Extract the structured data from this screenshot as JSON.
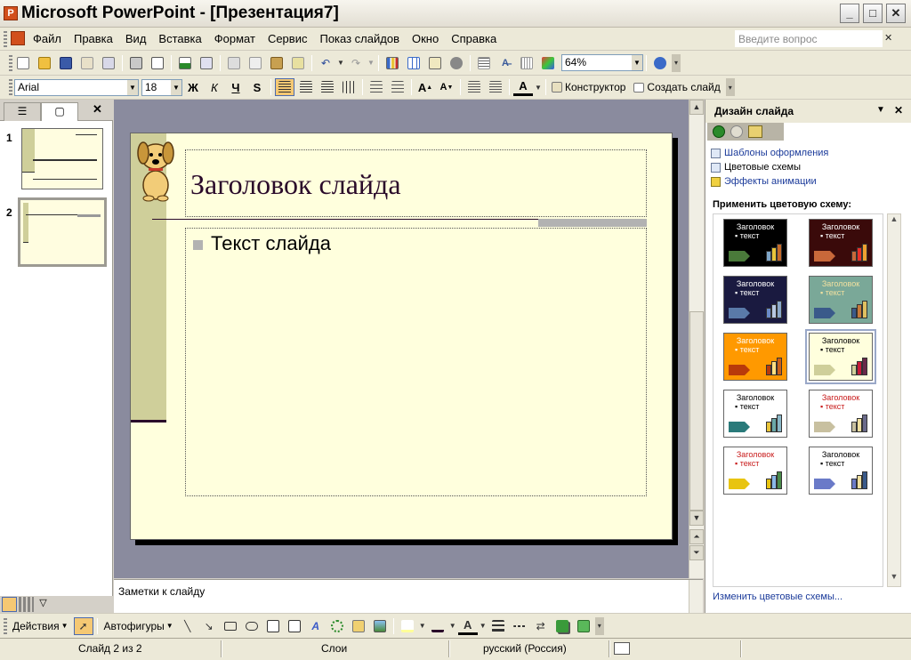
{
  "window": {
    "title": "Microsoft PowerPoint - [Презентация7]",
    "minimize": "_",
    "maximize": "□",
    "close": "✕"
  },
  "menu": {
    "items": [
      "Файл",
      "Правка",
      "Вид",
      "Вставка",
      "Формат",
      "Сервис",
      "Показ слайдов",
      "Окно",
      "Справка"
    ],
    "help_placeholder": "Введите вопрос",
    "help_close": "✕"
  },
  "standard_toolbar": {
    "zoom": "64%",
    "zoom_arrow": "▼"
  },
  "format_toolbar": {
    "font": "Arial",
    "font_size": "18",
    "bold": "Ж",
    "italic": "К",
    "underline": "Ч",
    "shadow": "S",
    "designer": "Конструктор",
    "new_slide": "Создать слайд"
  },
  "left_panel": {
    "close": "✕",
    "slides": [
      {
        "number": "1"
      },
      {
        "number": "2"
      }
    ]
  },
  "slide": {
    "title": "Заголовок слайда",
    "body": "Текст слайда"
  },
  "notes": {
    "placeholder": "Заметки к слайду"
  },
  "task_pane": {
    "title": "Дизайн слайда",
    "links": [
      "Шаблоны оформления",
      "Цветовые схемы",
      "Эффекты анимации"
    ],
    "apply_label": "Применить цветовую схему:",
    "footer_link": "Изменить цветовые схемы...",
    "schemes": [
      {
        "title": "Заголовок",
        "text": "текст",
        "bg": "#000000",
        "fg": "#ffffff",
        "arrow": "#4a7a3a",
        "bars": [
          "#7fa6c8",
          "#e8c43a",
          "#c46a2a"
        ]
      },
      {
        "title": "Заголовок",
        "text": "текст",
        "bg": "#3a0a0a",
        "fg": "#ffffff",
        "arrow": "#c8683a",
        "bars": [
          "#c8683a",
          "#e8302a",
          "#f0a030"
        ]
      },
      {
        "title": "Заголовок",
        "text": "текст",
        "bg": "#1a1a40",
        "fg": "#ffffff",
        "arrow": "#5a7aa8",
        "bars": [
          "#6a8ac8",
          "#b8c8e0",
          "#8aa8c8"
        ]
      },
      {
        "title": "Заголовок",
        "text": "текст",
        "bg": "#7aa898",
        "fg": "#f0e0a0",
        "arrow": "#3a5a8a",
        "bars": [
          "#3a5a8a",
          "#c87a3a",
          "#e0c060"
        ]
      },
      {
        "title": "Заголовок",
        "text": "текст",
        "bg": "#ff9900",
        "fg": "#ffffff",
        "arrow": "#b83a0a",
        "bars": [
          "#b83a0a",
          "#ffe080",
          "#c8601a"
        ]
      },
      {
        "title": "Заголовок",
        "text": "текст",
        "bg": "#ffffdd",
        "fg": "#000000",
        "arrow": "#cfcf9a",
        "bars": [
          "#cfcf9a",
          "#c81a3a",
          "#6a2a4a"
        ]
      },
      {
        "title": "Заголовок",
        "text": "текст",
        "bg": "#ffffff",
        "fg": "#000000",
        "arrow": "#2a7a7a",
        "bars": [
          "#e8c43a",
          "#6aa8a8",
          "#8ab8c8"
        ]
      },
      {
        "title": "Заголовок",
        "text": "текст",
        "bg": "#ffffff",
        "fg": "#c81a1a",
        "arrow": "#c8c0a0",
        "bars": [
          "#c8c0a0",
          "#f0e0a0",
          "#6a6a8a"
        ]
      },
      {
        "title": "Заголовок",
        "text": "текст",
        "bg": "#ffffff",
        "fg": "#c81a1a",
        "arrow": "#e8c410",
        "bars": [
          "#e8c410",
          "#8ab8e8",
          "#4a8a4a"
        ]
      },
      {
        "title": "Заголовок",
        "text": "текст",
        "bg": "#ffffff",
        "fg": "#000000",
        "arrow": "#6a7ac8",
        "bars": [
          "#6a7ac8",
          "#f0e0a0",
          "#3a5a8a"
        ]
      }
    ]
  },
  "draw_toolbar": {
    "actions": "Действия",
    "autoshapes": "Автофигуры"
  },
  "status": {
    "slide": "Слайд 2 из 2",
    "design": "Слои",
    "language": "русский (Россия)"
  }
}
